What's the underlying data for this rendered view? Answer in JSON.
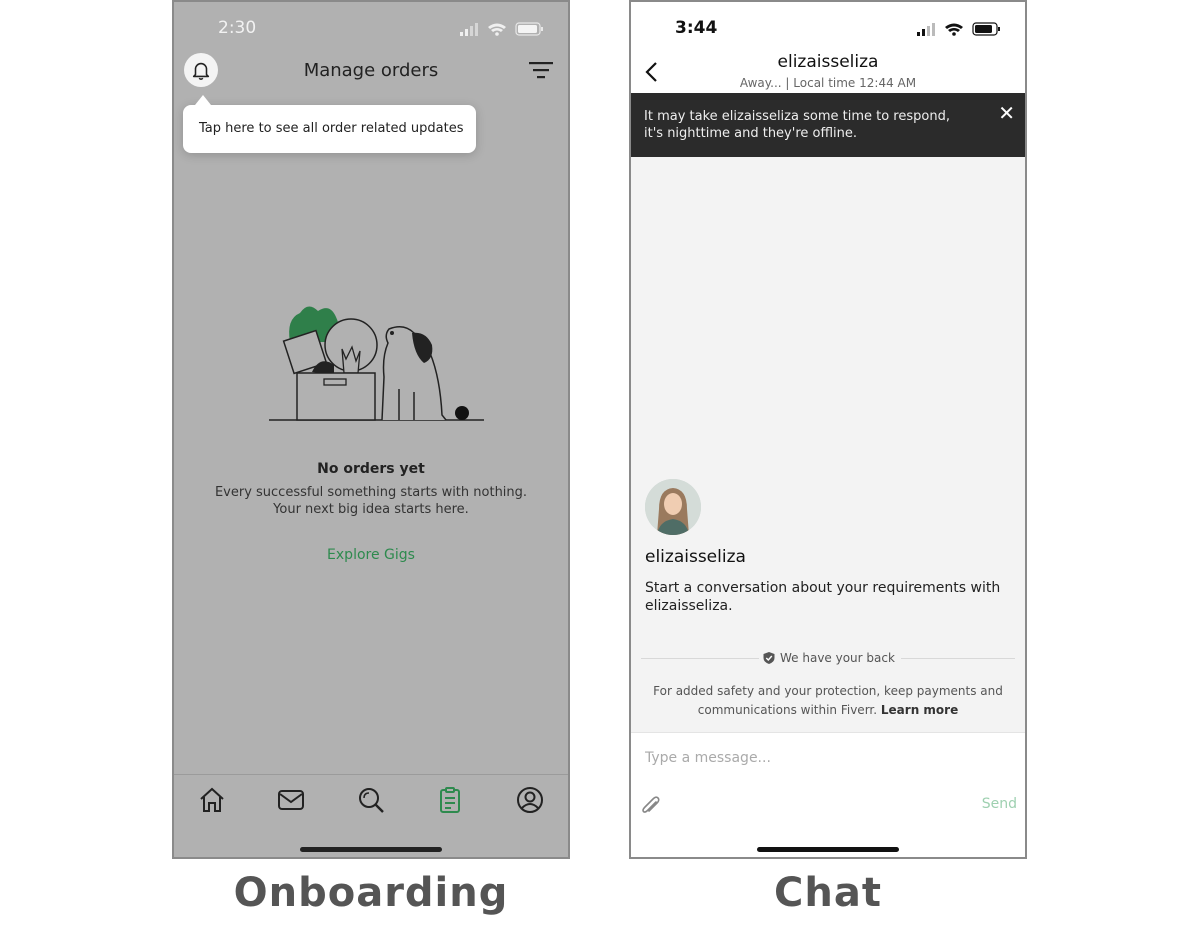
{
  "onboarding": {
    "status_time": "2:30",
    "title": "Manage orders",
    "tooltip": "Tap here to see all order related updates",
    "empty_title": "No orders yet",
    "empty_line1": "Every successful something starts with nothing.",
    "empty_line2": "Your next big idea starts here.",
    "explore_label": "Explore Gigs",
    "nav_icons": [
      "home-icon",
      "inbox-icon",
      "search-icon",
      "orders-icon",
      "profile-icon"
    ],
    "active_nav": "orders-icon",
    "accent_color": "#2e8a4e",
    "caption": "Onboarding"
  },
  "chat": {
    "status_time": "3:44",
    "username": "elizaisseliza",
    "subtitle": "Away... | Local time 12:44 AM",
    "banner_line1": "It may take elizaisseliza some time to respond,",
    "banner_line2": "it's nighttime and they're offline.",
    "seller_name": "elizaisseliza",
    "intro_line1": "Start a conversation about your requirements with",
    "intro_line2": "elizaisseliza.",
    "badge": "We have your back",
    "safety_line1": "For added safety and your protection, keep payments and",
    "safety_line2": "communications within Fiverr.",
    "learn_more": "Learn more",
    "input_placeholder": "Type a message...",
    "send_label": "Send",
    "caption": "Chat"
  }
}
